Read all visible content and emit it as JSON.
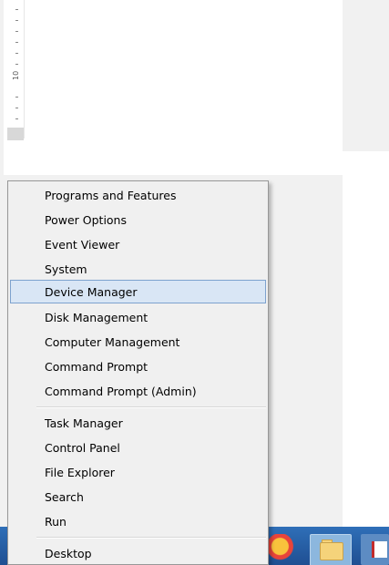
{
  "ruler": {
    "number": "10"
  },
  "menu": {
    "group1": [
      {
        "label": "Programs and Features",
        "highlighted": false
      },
      {
        "label": "Power Options",
        "highlighted": false
      },
      {
        "label": "Event Viewer",
        "highlighted": false
      },
      {
        "label": "System",
        "highlighted": false
      },
      {
        "label": "Device Manager",
        "highlighted": true
      },
      {
        "label": "Disk Management",
        "highlighted": false
      },
      {
        "label": "Computer Management",
        "highlighted": false
      },
      {
        "label": "Command Prompt",
        "highlighted": false
      },
      {
        "label": "Command Prompt (Admin)",
        "highlighted": false
      }
    ],
    "group2": [
      {
        "label": "Task Manager",
        "highlighted": false
      },
      {
        "label": "Control Panel",
        "highlighted": false
      },
      {
        "label": "File Explorer",
        "highlighted": false
      },
      {
        "label": "Search",
        "highlighted": false
      },
      {
        "label": "Run",
        "highlighted": false
      }
    ],
    "group3": [
      {
        "label": "Desktop",
        "highlighted": false
      }
    ]
  },
  "taskbar": {
    "icons": [
      "chrome-icon",
      "file-explorer-icon",
      "pdf-icon"
    ]
  },
  "colors": {
    "highlight_bg": "#d9e6f5",
    "highlight_border": "#7da2ce",
    "taskbar": "#2f6fb8"
  }
}
